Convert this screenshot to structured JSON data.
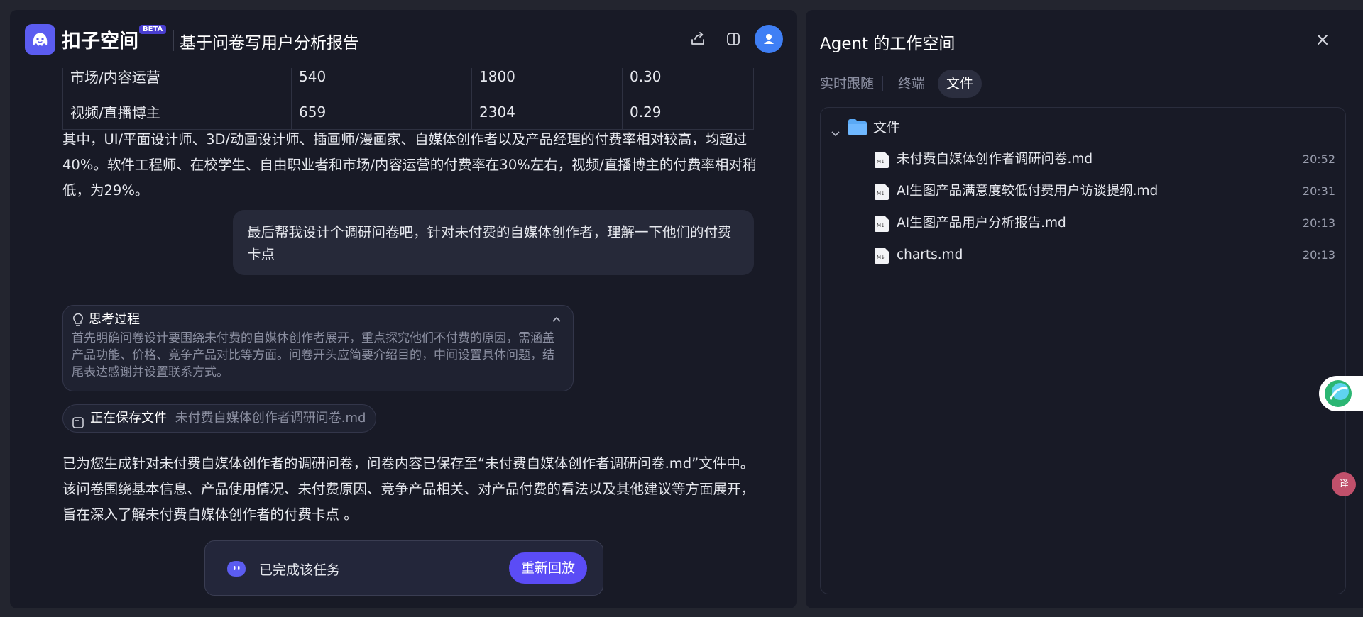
{
  "app": {
    "name": "扣子空间",
    "badge": "BETA"
  },
  "header": {
    "title": "基于问卷写用户分析报告"
  },
  "table": {
    "rows": [
      [
        "市场/内容运营",
        "540",
        "1800",
        "0.30"
      ],
      [
        "视频/直播博主",
        "659",
        "2304",
        "0.29"
      ]
    ]
  },
  "content": {
    "summary_paragraph": "其中，UI/平面设计师、3D/动画设计师、插画师/漫画家、自媒体创作者以及产品经理的付费率相对较高，均超过40%。软件工程师、在校学生、自由职业者和市场/内容运营的付费率在30%左右，视频/直播博主的付费率相对稍低，为29%。",
    "user_message": "最后帮我设计个调研问卷吧，针对未付费的自媒体创作者，理解一下他们的付费卡点",
    "thinking": {
      "title": "思考过程",
      "body": "首先明确问卷设计要围绕未付费的自媒体创作者展开，重点探究他们不付费的原因，需涵盖产品功能、价格、竞争产品对比等方面。问卷开头应简要介绍目的，中间设置具体问题，结尾表达感谢并设置联系方式。"
    },
    "saving": {
      "label": "正在保存文件",
      "filename": "未付费自媒体创作者调研问卷.md"
    },
    "result_paragraph": "已为您生成针对未付费自媒体创作者的调研问卷，问卷内容已保存至“未付费自媒体创作者调研问卷.md”文件中。该问卷围绕基本信息、产品使用情况、未付费原因、竞争产品相关、对产品付费的看法以及其他建议等方面展开，旨在深入了解未付费自媒体创作者的付费卡点 。",
    "task_status": "已完成该任务",
    "replay_button": "重新回放"
  },
  "workspace": {
    "title": "Agent 的工作空间",
    "tabs": [
      "实时跟随",
      "终端",
      "文件"
    ],
    "active_tab": "文件",
    "folder_name": "文件",
    "files": [
      {
        "name": "未付费自媒体创作者调研问卷.md",
        "time": "20:52"
      },
      {
        "name": "AI生图产品满意度较低付费用户访谈提纲.md",
        "time": "20:31"
      },
      {
        "name": "AI生图产品用户分析报告.md",
        "time": "20:13"
      },
      {
        "name": "charts.md",
        "time": "20:13"
      }
    ]
  },
  "colors": {
    "accent": "#5b4cf6",
    "avatar": "#3f7ff5",
    "folder": "#5aa9f5",
    "background": "#181a26"
  }
}
